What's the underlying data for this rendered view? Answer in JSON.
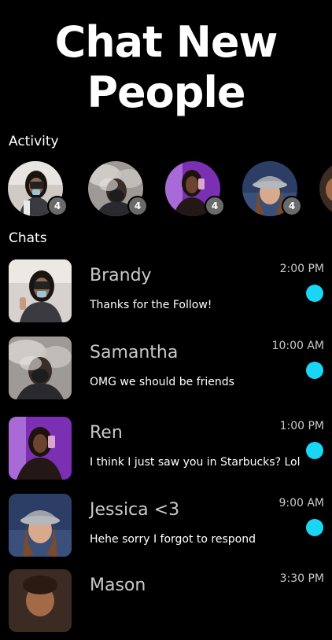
{
  "hero": {
    "line1": "Chat New",
    "line2": "People"
  },
  "activity": {
    "label": "Activity",
    "stories": [
      {
        "count": "4",
        "avatar": "girl-with-phone-mirror-selfie"
      },
      {
        "count": "4",
        "avatar": "smoke-masked-selfie"
      },
      {
        "count": "4",
        "avatar": "purple-room-selfie"
      },
      {
        "count": "4",
        "avatar": "bucket-hat-selfie"
      }
    ]
  },
  "chats": {
    "label": "Chats",
    "items": [
      {
        "name": "Brandy",
        "message": "Thanks for the Follow!",
        "time": "2:00 PM",
        "unread_color": "#1ad6f5"
      },
      {
        "name": "Samantha",
        "message": "OMG we should be friends",
        "time": "10:00 AM",
        "unread_color": "#1ad6f5"
      },
      {
        "name": "Ren",
        "message": "I think I just saw you in Starbucks? Lol",
        "time": "1:00 PM",
        "unread_color": "#1ad6f5"
      },
      {
        "name": "Jessica <3",
        "message": "Hehe sorry I forgot to respond",
        "time": "9:00 AM",
        "unread_color": "#1ad6f5"
      },
      {
        "name": "Mason",
        "message": "",
        "time": "3:30 PM",
        "unread_color": "#1ad6f5"
      }
    ]
  },
  "colors": {
    "background": "#000000",
    "accent_unread": "#1ad6f5",
    "badge": "#6a6a6a"
  }
}
